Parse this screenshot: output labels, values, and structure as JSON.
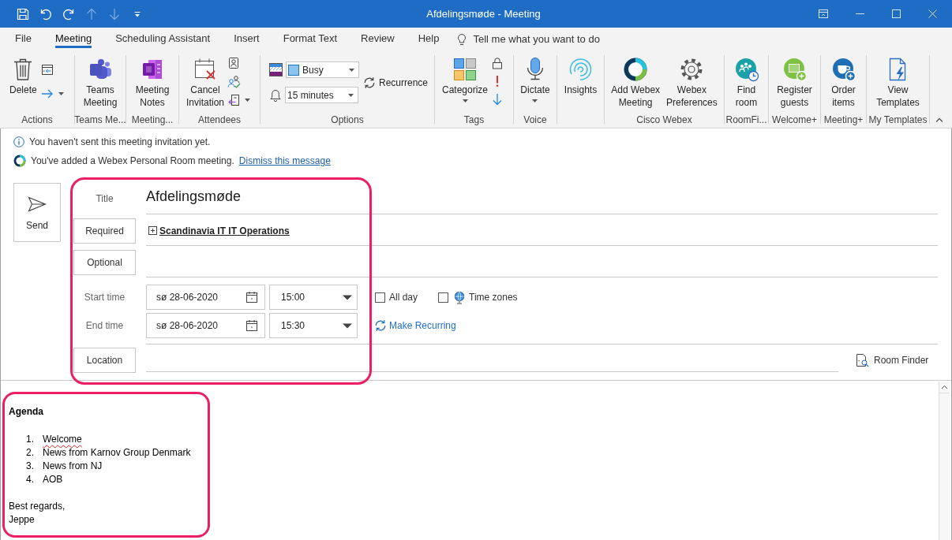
{
  "window": {
    "title": "Afdelingsmøde - Meeting"
  },
  "quick_access": [
    {
      "kind": "save",
      "disabled": false
    },
    {
      "kind": "undo",
      "disabled": false
    },
    {
      "kind": "redo",
      "disabled": false
    },
    {
      "kind": "up",
      "disabled": true
    },
    {
      "kind": "down",
      "disabled": true
    }
  ],
  "tabs": [
    {
      "label": "File",
      "selected": false
    },
    {
      "label": "Meeting",
      "selected": true
    },
    {
      "label": "Scheduling Assistant",
      "selected": false
    },
    {
      "label": "Insert",
      "selected": false
    },
    {
      "label": "Format Text",
      "selected": false
    },
    {
      "label": "Review",
      "selected": false
    },
    {
      "label": "Help",
      "selected": false
    }
  ],
  "tell_me": "Tell me what you want to do",
  "ribbon": {
    "groups": [
      {
        "label": "Actions",
        "buttons": [
          {
            "label": "Delete"
          }
        ]
      },
      {
        "label": "Teams Me...",
        "buttons": [
          {
            "label": "Teams\nMeeting"
          }
        ]
      },
      {
        "label": "Meeting...",
        "buttons": [
          {
            "label": "Meeting\nNotes"
          }
        ]
      },
      {
        "label": "Attendees",
        "buttons": [
          {
            "label": "Cancel\nInvitation"
          }
        ]
      },
      {
        "label": "Options",
        "show_as": "Busy",
        "reminder": "15 minutes",
        "recurrence": "Recurrence"
      },
      {
        "label": "Tags",
        "buttons": [
          {
            "label": "Categorize",
            "dropdown": true
          }
        ]
      },
      {
        "label": "Voice",
        "buttons": [
          {
            "label": "Dictate",
            "dropdown": true
          }
        ]
      },
      {
        "buttons": [
          {
            "label": "Insights"
          }
        ]
      },
      {
        "label": "Cisco Webex",
        "buttons": [
          {
            "label": "Add Webex\nMeeting"
          },
          {
            "label": "Webex\nPreferences"
          }
        ]
      },
      {
        "label": "RoomFi...",
        "buttons": [
          {
            "label": "Find\nroom"
          }
        ]
      },
      {
        "label": "Welcome+",
        "buttons": [
          {
            "label": "Register\nguests"
          }
        ]
      },
      {
        "label": "Meeting+",
        "buttons": [
          {
            "label": "Order\nitems"
          }
        ]
      },
      {
        "label": "My Templates",
        "buttons": [
          {
            "label": "View\nTemplates"
          }
        ]
      }
    ]
  },
  "notifications": [
    {
      "kind": "info",
      "text": "You haven't sent this meeting invitation yet."
    },
    {
      "kind": "webex",
      "text": "You've added a Webex Personal Room meeting.",
      "link": "Dismiss this message"
    }
  ],
  "send": "Send",
  "form": {
    "title": {
      "label": "Title",
      "value": "Afdelingsmøde"
    },
    "required": {
      "label": "Required",
      "value": "Scandinavia IT IT Operations"
    },
    "optional": {
      "label": "Optional"
    },
    "start": {
      "label": "Start time",
      "date": "sø 28-06-2020",
      "time": "15:00"
    },
    "end": {
      "label": "End time",
      "date": "sø 28-06-2020",
      "time": "15:30"
    },
    "all_day": {
      "label": "All day",
      "checked": false
    },
    "time_zones": {
      "label": "Time zones",
      "checked": false
    },
    "make_recurring": "Make Recurring",
    "location": {
      "label": "Location"
    },
    "room_finder": "Room Finder"
  },
  "body": {
    "heading": "Agenda",
    "items": [
      {
        "number": "1.",
        "text": "Welcome",
        "spelling_error": true
      },
      {
        "number": "2.",
        "text": "News from Karnov Group Denmark",
        "spelling_error": false
      },
      {
        "number": "3.",
        "text": "News from NJ",
        "spelling_error": false
      },
      {
        "number": "4.",
        "text": "AOB",
        "spelling_error": false
      }
    ],
    "closing": [
      "Best regards,",
      "Jeppe"
    ]
  }
}
